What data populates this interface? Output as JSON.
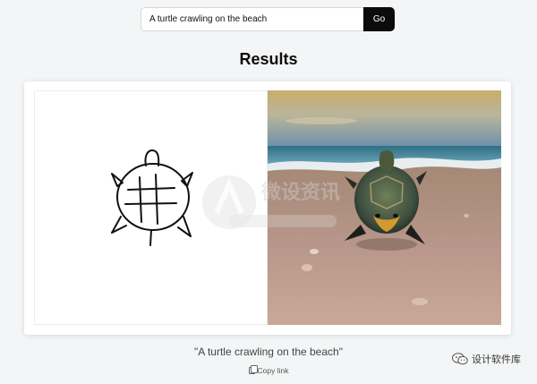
{
  "search": {
    "value": "A turtle crawling on the beach",
    "go_label": "Go"
  },
  "results": {
    "title": "Results",
    "caption": "\"A turtle crawling on the beach\"",
    "copy_link_label": "Copy link"
  },
  "images": {
    "sketch_icon": "turtle-sketch",
    "photo_icon": "turtle-beach-photo"
  },
  "watermark": {
    "text": "微设资讯"
  },
  "brand": {
    "label": "设计软件库"
  },
  "colors": {
    "go_button": "#0b0b0b",
    "page_background": "#f4f5f6"
  }
}
